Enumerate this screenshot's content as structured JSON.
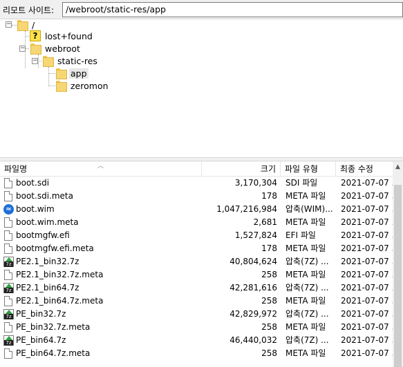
{
  "pathbar": {
    "label": "리모트 사이트:",
    "path": "/webroot/static-res/app"
  },
  "tree": {
    "root": "/",
    "lost_found": "lost+found",
    "webroot": "webroot",
    "static_res": "static-res",
    "app": "app",
    "zeromon": "zeromon"
  },
  "list": {
    "columns": {
      "name": "파일명",
      "size": "크기",
      "type": "파일 유형",
      "date": "최종 수정"
    },
    "files": [
      {
        "name": "boot.sdi",
        "size": "3,170,304",
        "type": "SDI 파일",
        "date": "2021-07-07 ...",
        "icon": "file"
      },
      {
        "name": "boot.sdi.meta",
        "size": "178",
        "type": "META 파일",
        "date": "2021-07-07 ...",
        "icon": "file"
      },
      {
        "name": "boot.wim",
        "size": "1,047,216,984",
        "type": "압축(WIM)...",
        "date": "2021-07-07 ...",
        "icon": "wim"
      },
      {
        "name": "boot.wim.meta",
        "size": "2,681",
        "type": "META 파일",
        "date": "2021-07-07 ...",
        "icon": "file"
      },
      {
        "name": "bootmgfw.efi",
        "size": "1,527,824",
        "type": "EFI 파일",
        "date": "2021-07-07 ...",
        "icon": "file"
      },
      {
        "name": "bootmgfw.efi.meta",
        "size": "178",
        "type": "META 파일",
        "date": "2021-07-07 ...",
        "icon": "file"
      },
      {
        "name": "PE2.1_bin32.7z",
        "size": "40,804,624",
        "type": "압축(7Z) ...",
        "date": "2021-07-07 ...",
        "icon": "7z"
      },
      {
        "name": "PE2.1_bin32.7z.meta",
        "size": "258",
        "type": "META 파일",
        "date": "2021-07-07 ...",
        "icon": "file"
      },
      {
        "name": "PE2.1_bin64.7z",
        "size": "42,281,616",
        "type": "압축(7Z) ...",
        "date": "2021-07-07 ...",
        "icon": "7z"
      },
      {
        "name": "PE2.1_bin64.7z.meta",
        "size": "258",
        "type": "META 파일",
        "date": "2021-07-07 ...",
        "icon": "file"
      },
      {
        "name": "PE_bin32.7z",
        "size": "42,829,972",
        "type": "압축(7Z) ...",
        "date": "2021-07-07 ...",
        "icon": "7z"
      },
      {
        "name": "PE_bin32.7z.meta",
        "size": "258",
        "type": "META 파일",
        "date": "2021-07-07 ...",
        "icon": "file"
      },
      {
        "name": "PE_bin64.7z",
        "size": "46,440,032",
        "type": "압축(7Z) ...",
        "date": "2021-07-07 ...",
        "icon": "7z"
      },
      {
        "name": "PE_bin64.7z.meta",
        "size": "258",
        "type": "META 파일",
        "date": "2021-07-07 ...",
        "icon": "file"
      }
    ]
  },
  "colors": {
    "folder": "#f7d774",
    "selection": "#e8e8e8",
    "wim_icon": "#1d6fd6",
    "7z_icon": "#2ea043"
  }
}
